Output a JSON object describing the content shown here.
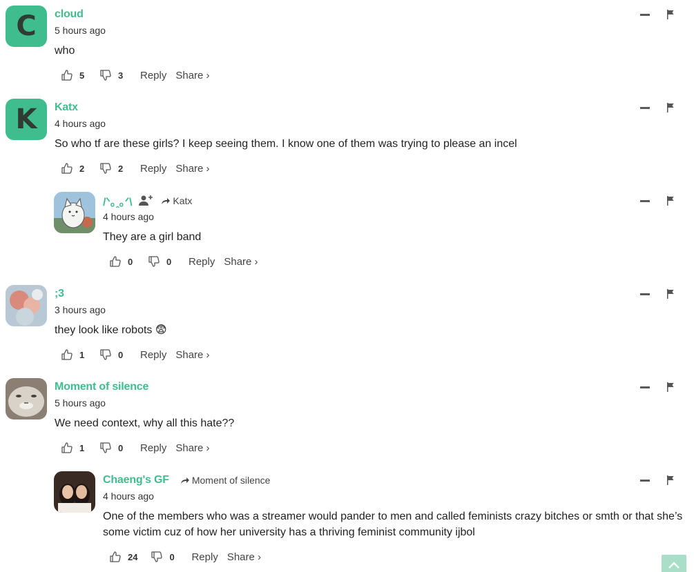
{
  "colors": {
    "accent": "#3fbd8e",
    "text": "#222222",
    "muted": "#444444"
  },
  "icons": {
    "like": "thumbs-up-icon",
    "dislike": "thumbs-down-icon",
    "collapse": "minus-icon",
    "flag": "flag-icon",
    "reply_to": "arrow-right-icon",
    "follow": "add-user-icon",
    "scroll_top": "chevron-up-icon"
  },
  "labels": {
    "reply": "Reply",
    "share": "Share ›"
  },
  "comments": [
    {
      "author": "cloud",
      "avatar_letter": "C",
      "time": "5 hours ago",
      "text": "who",
      "likes": "5",
      "dislikes": "3"
    },
    {
      "author": "Katx",
      "avatar_letter": "K",
      "time": "4 hours ago",
      "text": "So who tf are these girls? I keep seeing them. I know one of them was trying to please an incel",
      "likes": "2",
      "dislikes": "2"
    },
    {
      "author": "/ᐠ｡ꞈ｡ᐟ\\",
      "reply_to": "Katx",
      "time": "4 hours ago",
      "text": "They are a girl band",
      "likes": "0",
      "dislikes": "0"
    },
    {
      "author": ";3",
      "time": "3 hours ago",
      "text": "they look like robots 😨",
      "likes": "1",
      "dislikes": "0"
    },
    {
      "author": "Moment of silence",
      "time": "5 hours ago",
      "text": "We need context, why all this hate??",
      "likes": "1",
      "dislikes": "0"
    },
    {
      "author": "Chaeng's GF",
      "reply_to": "Moment of silence",
      "time": "4 hours ago",
      "text": "One of the members who was a streamer would pander to men and called feminists crazy bitches or smth or that she’s some victim cuz of how her university has a thriving feminist community ijbol",
      "likes": "24",
      "dislikes": "0"
    }
  ]
}
